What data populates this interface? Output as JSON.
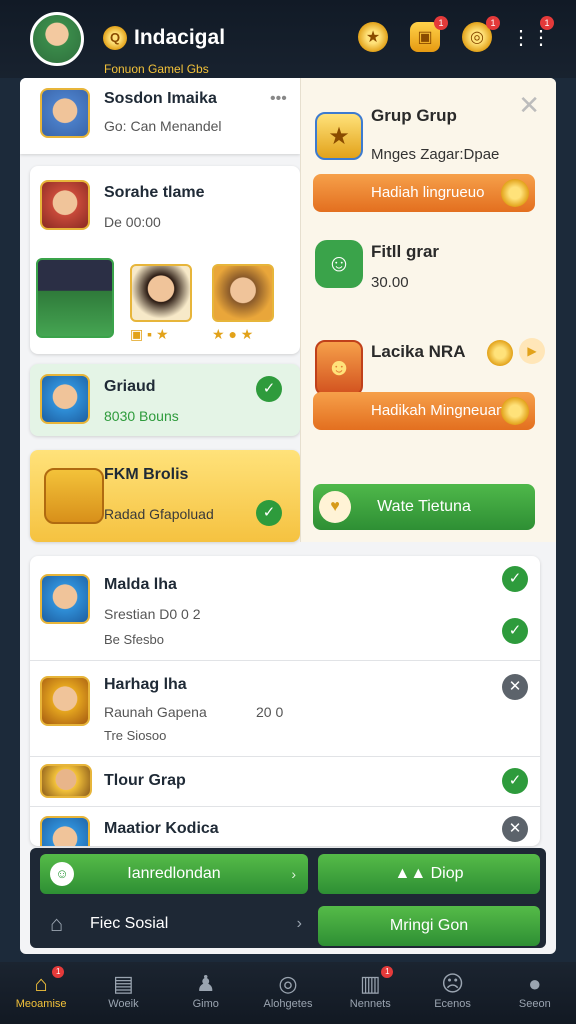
{
  "header": {
    "title": "Indacigal",
    "subtitle": "Fonuon Gamel Gbs",
    "icons": [
      "avatar",
      "trophy-icon",
      "chest-icon",
      "coin-icon",
      "more-icon"
    ],
    "badges": [
      "1",
      "1",
      "1"
    ]
  },
  "list": {
    "items": [
      {
        "title": "Sosdon Imaika",
        "sub": "Go: Can Menandel",
        "status": "none"
      },
      {
        "title": "Sorahe tlame",
        "sub": "De  00:00",
        "status": "none"
      },
      {
        "title": "Griaud",
        "sub": "8030 Bouns",
        "status": "check"
      },
      {
        "title": "FKM Brolis",
        "sub": "Radad Gfapoluad",
        "status": "check"
      },
      {
        "title": "Malda lha",
        "sub": "Srestian  D0  0 2",
        "meta": "Be Sfesbo",
        "status": "check"
      },
      {
        "title": "Harhag lha",
        "sub": "Raunah Gapena",
        "value": "20 0",
        "meta": "Tre Siosoo",
        "status": "x"
      },
      {
        "title": "Tlour Grap",
        "status": "check"
      },
      {
        "title": "Maatior Kodica",
        "status": "x"
      }
    ]
  },
  "right_panel": {
    "close": "✕",
    "sections": [
      {
        "title": "Grup Grup",
        "sub": "Mnges Zagar:Dpae",
        "button": "Hadiah lingrueuo"
      },
      {
        "title": "Fitll grar",
        "sub": "30.00"
      },
      {
        "title": "Lacika NRA",
        "button": "Hadikah Mingneuan"
      }
    ],
    "green_button": "Wate Tietuna"
  },
  "action_bar": {
    "primary": "Ianredlondan",
    "secondary": "Diop",
    "dark": "Fiec Sosial",
    "bottom_right": "Mringi Gon"
  },
  "nav": {
    "items": [
      {
        "label": "Meoamise",
        "icon": "home-icon",
        "active": true,
        "badge": "1"
      },
      {
        "label": "Woeik",
        "icon": "cards-icon"
      },
      {
        "label": "Gimo",
        "icon": "user-icon"
      },
      {
        "label": "Alohgetes",
        "icon": "compass-icon"
      },
      {
        "label": "Nennets",
        "icon": "calendar-icon",
        "badge": "1"
      },
      {
        "label": "Ecenos",
        "icon": "face-icon"
      },
      {
        "label": "Seeon",
        "icon": "profile-icon"
      }
    ]
  },
  "colors": {
    "accent_green": "#2e9b3c",
    "accent_orange": "#e36f1f",
    "accent_gold": "#f3c23a",
    "background": "#1c2a3a"
  }
}
